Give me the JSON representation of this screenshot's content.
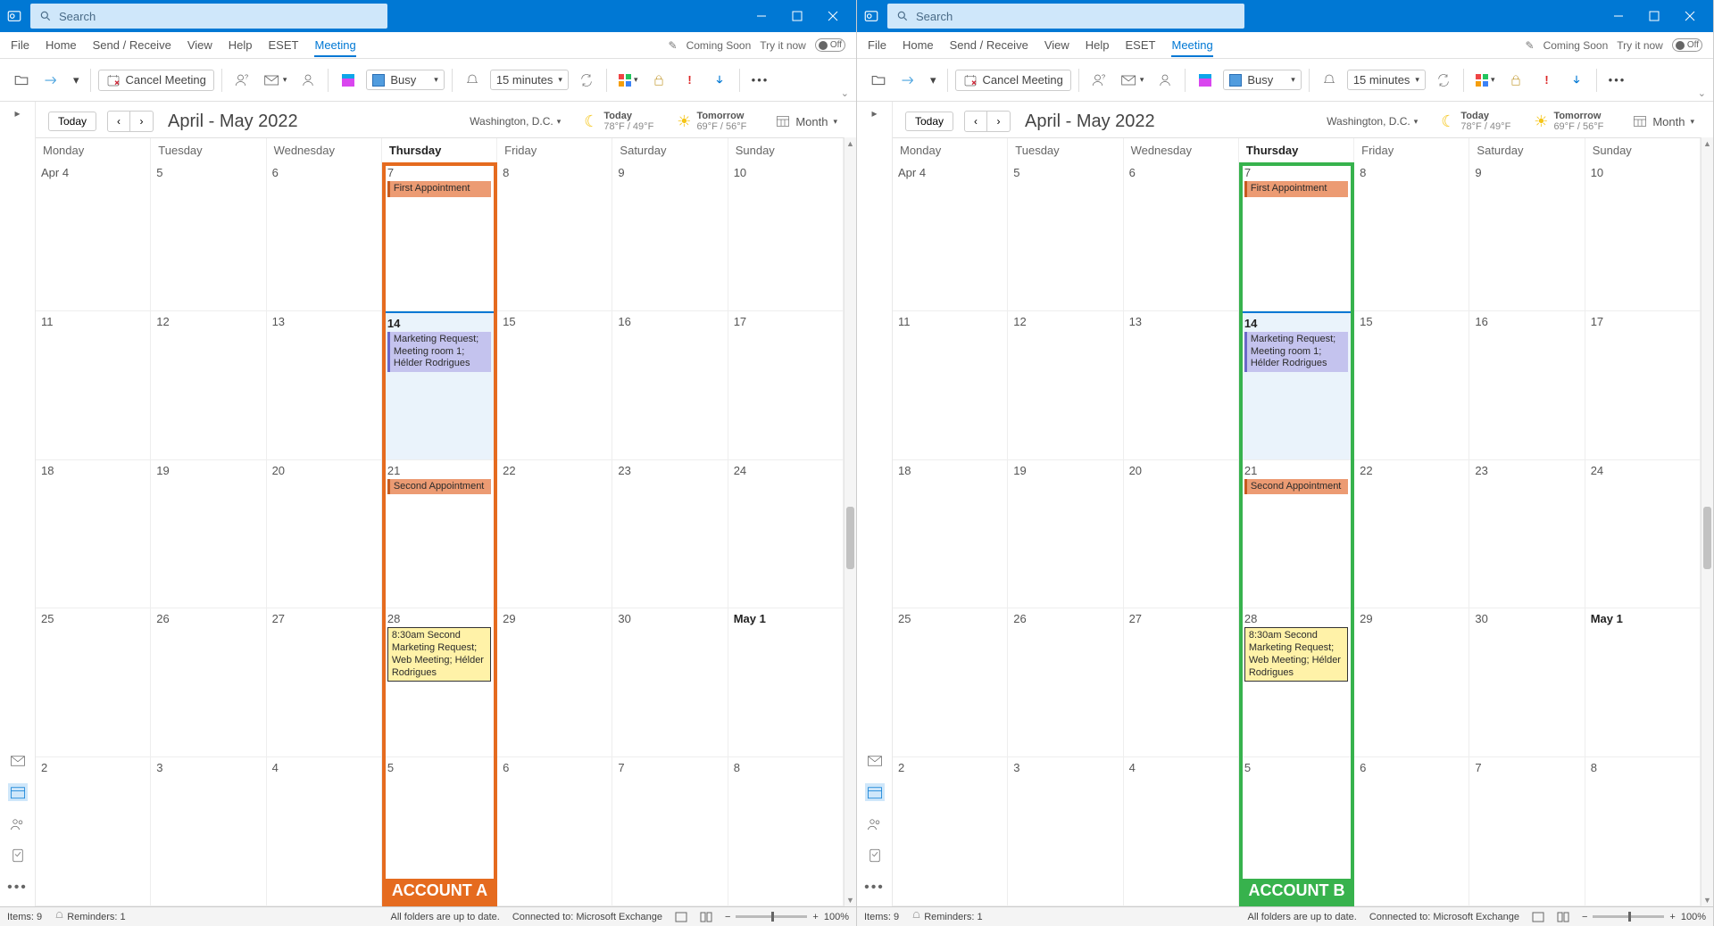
{
  "search_placeholder": "Search",
  "menu": {
    "file": "File",
    "home": "Home",
    "sendreceive": "Send / Receive",
    "view": "View",
    "help": "Help",
    "eset": "ESET",
    "meeting": "Meeting"
  },
  "menu_right": {
    "coming": "Coming Soon",
    "try": "Try it now",
    "off": "Off"
  },
  "toolbar": {
    "cancel": "Cancel Meeting",
    "busy": "Busy",
    "reminder": "15 minutes"
  },
  "header": {
    "today_btn": "Today",
    "title": "April - May 2022",
    "location": "Washington, D.C.",
    "today_lbl": "Today",
    "today_temp": "78°F / 49°F",
    "tomorrow_lbl": "Tomorrow",
    "tomorrow_temp": "69°F / 56°F",
    "view": "Month"
  },
  "dow": [
    "Monday",
    "Tuesday",
    "Wednesday",
    "Thursday",
    "Friday",
    "Saturday",
    "Sunday"
  ],
  "weeks": [
    [
      {
        "n": "Apr 4"
      },
      {
        "n": "5"
      },
      {
        "n": "6"
      },
      {
        "n": "7",
        "evts": [
          {
            "t": "First Appointment",
            "c": "orange"
          }
        ]
      },
      {
        "n": "8"
      },
      {
        "n": "9"
      },
      {
        "n": "10"
      }
    ],
    [
      {
        "n": "11"
      },
      {
        "n": "12"
      },
      {
        "n": "13"
      },
      {
        "n": "14",
        "today": true,
        "evts": [
          {
            "t": "Marketing Request; Meeting room 1; Hélder Rodrigues",
            "c": "purple"
          }
        ]
      },
      {
        "n": "15"
      },
      {
        "n": "16"
      },
      {
        "n": "17"
      }
    ],
    [
      {
        "n": "18"
      },
      {
        "n": "19"
      },
      {
        "n": "20"
      },
      {
        "n": "21",
        "evts": [
          {
            "t": "Second Appointment",
            "c": "orange"
          }
        ]
      },
      {
        "n": "22"
      },
      {
        "n": "23"
      },
      {
        "n": "24"
      }
    ],
    [
      {
        "n": "25"
      },
      {
        "n": "26"
      },
      {
        "n": "27"
      },
      {
        "n": "28",
        "evts": [
          {
            "t": "8:30am Second Marketing Request; Web Meeting; Hélder Rodrigues",
            "c": "yellow"
          }
        ]
      },
      {
        "n": "29"
      },
      {
        "n": "30"
      },
      {
        "n": "May 1",
        "bold": true
      }
    ],
    [
      {
        "n": "2"
      },
      {
        "n": "3"
      },
      {
        "n": "4"
      },
      {
        "n": "5"
      },
      {
        "n": "6"
      },
      {
        "n": "7"
      },
      {
        "n": "8"
      }
    ]
  ],
  "accounts": {
    "a": "ACCOUNT A",
    "b": "ACCOUNT B"
  },
  "status": {
    "items": "Items: 9",
    "reminders": "Reminders: 1",
    "folders": "All folders are up to date.",
    "connected": "Connected to: Microsoft Exchange",
    "zoom": "100%"
  }
}
